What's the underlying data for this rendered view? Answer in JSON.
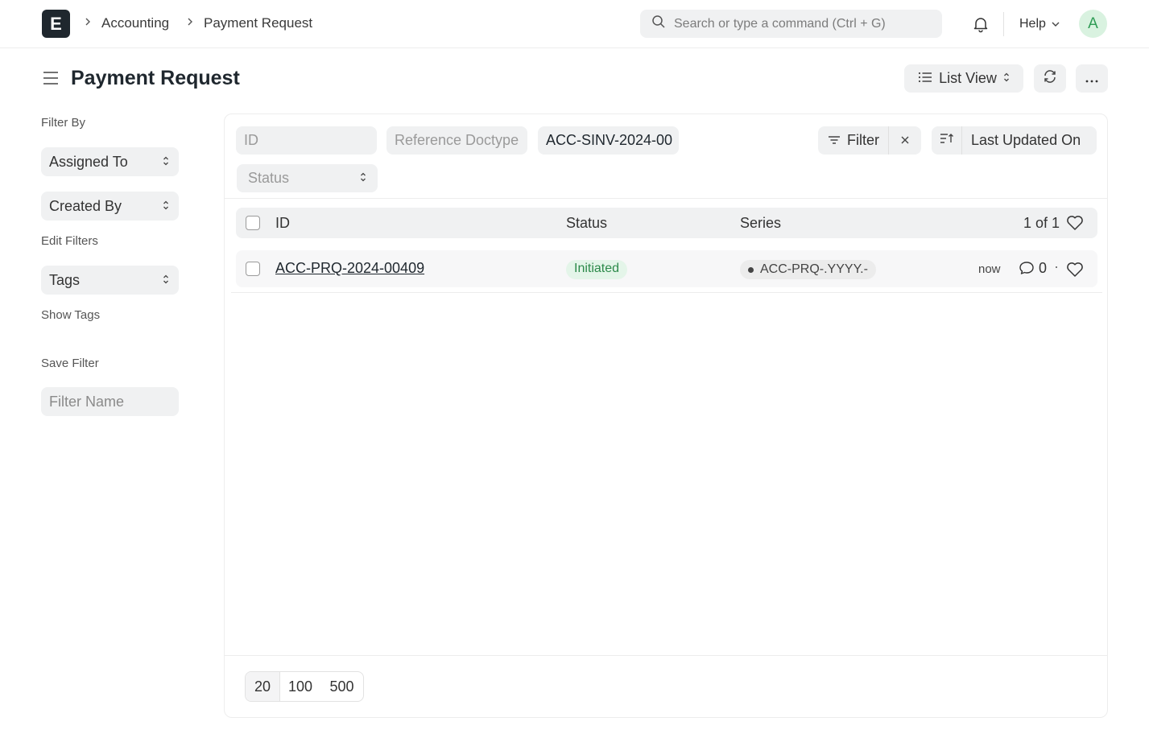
{
  "navbar": {
    "logo_letter": "E",
    "breadcrumbs": [
      "Accounting",
      "Payment Request"
    ],
    "search_placeholder": "Search or type a command (Ctrl + G)",
    "help_label": "Help",
    "avatar_initial": "A"
  },
  "page": {
    "title": "Payment Request",
    "list_view_label": "List View"
  },
  "sidebar": {
    "filter_by_label": "Filter By",
    "assigned_to_label": "Assigned To",
    "created_by_label": "Created By",
    "edit_filters_label": "Edit Filters",
    "tags_label": "Tags",
    "show_tags_label": "Show Tags",
    "save_filter_label": "Save Filter",
    "filter_name_placeholder": "Filter Name"
  },
  "filters": {
    "id_placeholder": "ID",
    "reference_doctype_placeholder": "Reference Doctype",
    "reference_name_value": "ACC-SINV-2024-00",
    "status_placeholder": "Status",
    "filter_label": "Filter",
    "sort_label": "Last Updated On"
  },
  "list": {
    "columns": {
      "id": "ID",
      "status": "Status",
      "series": "Series"
    },
    "count_label": "1 of 1",
    "rows": [
      {
        "id": "ACC-PRQ-2024-00409",
        "status": "Initiated",
        "series": "ACC-PRQ-.YYYY.-",
        "modified": "now",
        "comment_count": "0"
      }
    ]
  },
  "pagination": {
    "page_sizes": [
      "20",
      "100",
      "500"
    ],
    "selected": "20"
  },
  "colors": {
    "status_initiated_bg": "#e4f5e9",
    "status_initiated_text": "#2c8a4a",
    "avatar_bg": "#d9f2e0",
    "avatar_text": "#2f9c55"
  }
}
